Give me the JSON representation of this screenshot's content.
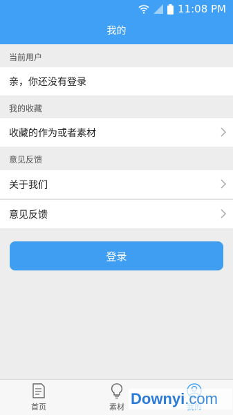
{
  "status_bar": {
    "time": "11:08 PM"
  },
  "header": {
    "title": "我的"
  },
  "sections": [
    {
      "header": "当前用户",
      "rows": [
        {
          "label": "亲，你还没有登录"
        }
      ]
    },
    {
      "header": "我的收藏",
      "rows": [
        {
          "label": "收藏的作为或者素材"
        }
      ]
    },
    {
      "header": "意见反馈",
      "rows": [
        {
          "label": "关于我们"
        },
        {
          "label": "意见反馈"
        }
      ]
    }
  ],
  "login_button": {
    "label": "登录"
  },
  "tabs": [
    {
      "label": "首页",
      "icon": "home-doc-icon",
      "active": false
    },
    {
      "label": "素材",
      "icon": "lightbulb-icon",
      "active": false
    },
    {
      "label": "我的",
      "icon": "profile-icon",
      "active": true
    }
  ],
  "watermark": {
    "brand": "Downyi",
    "suffix": ".com"
  },
  "colors": {
    "primary": "#3fa0f5",
    "background": "#ededed",
    "row": "#ffffff"
  }
}
